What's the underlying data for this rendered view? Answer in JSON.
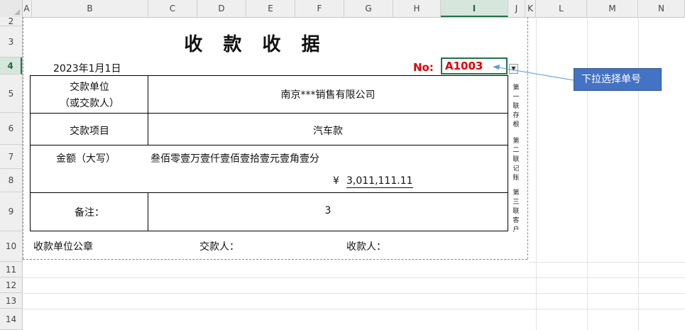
{
  "grid": {
    "columns": [
      "A",
      "B",
      "C",
      "D",
      "E",
      "F",
      "G",
      "H",
      "I",
      "J",
      "K",
      "L",
      "M",
      "N"
    ],
    "selected_column": "I",
    "rows": [
      "2",
      "3",
      "4",
      "5",
      "6",
      "7",
      "8",
      "9",
      "10",
      "11",
      "12",
      "13",
      "14"
    ],
    "selected_row": "4"
  },
  "receipt": {
    "title": "收 款 收 据",
    "date": "2023年1月1日",
    "no_label": "No:",
    "no_value": "A1003",
    "dropdown_glyph": "▼",
    "payer_label_line1": "交款单位",
    "payer_label_line2": "（或交款人）",
    "payer_value": "南京***销售有限公司",
    "item_label": "交款项目",
    "item_value": "汽车款",
    "amount_label": "金额（大写）",
    "amount_words": "叁佰零壹万壹仟壹佰壹拾壹元壹角壹分",
    "currency_symbol": "¥",
    "amount_number": "3,011,111.11",
    "remark_label": "备注：",
    "remark_value": "3",
    "seal_label": "收款单位公章",
    "handler_label": "交款人：",
    "receiver_label": "收款人："
  },
  "side_labels": [
    "第一联存根",
    "第二联记账",
    "第三联客户"
  ],
  "callout": {
    "text": "下拉选择单号"
  },
  "colors": {
    "accent_green": "#217346",
    "number_red": "#e00000",
    "callout_blue": "#4472c4",
    "arrow_blue": "#5b9bd5"
  }
}
